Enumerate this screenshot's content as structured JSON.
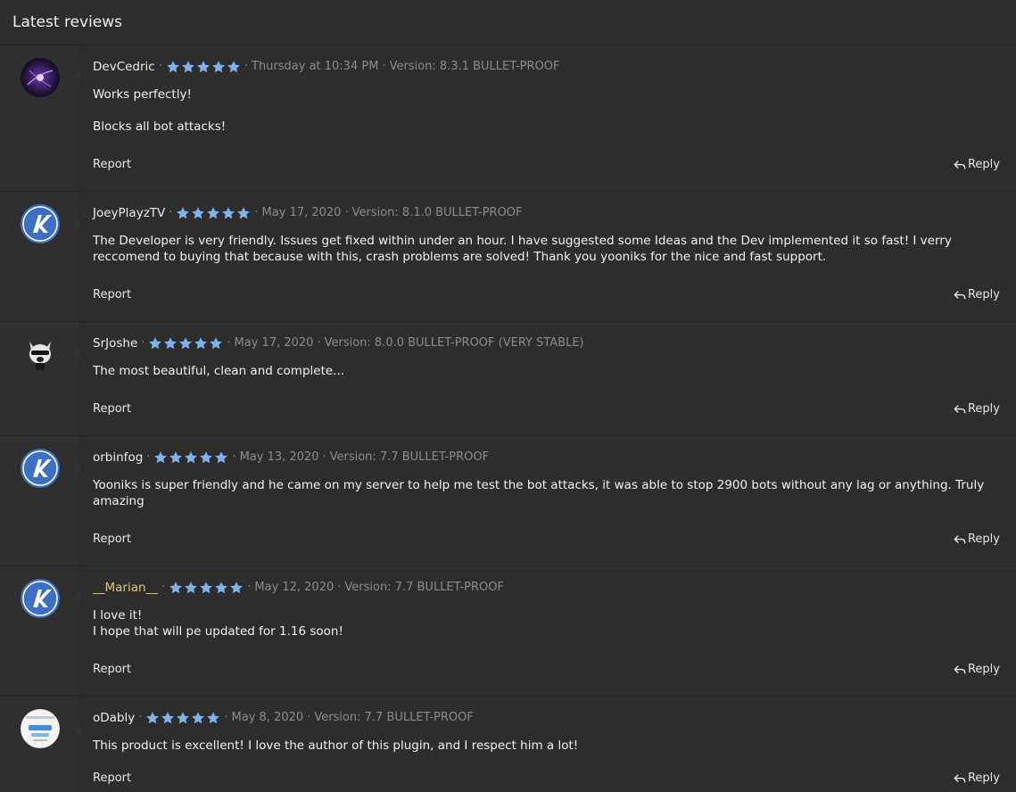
{
  "block": {
    "title": "Latest reviews"
  },
  "colors": {
    "star": "#7fb3ee",
    "highlight_user": "#e5c76b",
    "background": "#2d2d2d"
  },
  "reviews": [
    {
      "username": "DevCedric",
      "stars": 5,
      "date": "Thursday at 10:34 PM",
      "version": "Version: 8.3.1 BULLET-PROOF",
      "lines": [
        "Works perfectly!",
        "Blocks all bot attacks!"
      ],
      "report": "Report",
      "reply": "Reply",
      "avatar_icon": "purple-lights-avatar-icon"
    },
    {
      "username": "JoeyPlayzTV",
      "stars": 5,
      "date": "May 17, 2020",
      "version": "Version: 8.1.0 BULLET-PROOF",
      "lines": [
        "The Developer is very friendly. Issues get fixed within under an hour. I have suggested some Ideas and the Dev implemented it so fast! I verry reccomend to buying that because with this, crash problems are solved! Thank you yooniks for the nice and fast support."
      ],
      "report": "Report",
      "reply": "Reply",
      "avatar_icon": "k-logo-avatar-icon"
    },
    {
      "username": "SrJoshe",
      "stars": 5,
      "date": "May 17, 2020",
      "version": "Version: 8.0.0 BULLET-PROOF (VERY STABLE)",
      "lines": [
        "The most beautiful, clean and complete..."
      ],
      "report": "Report",
      "reply": "Reply",
      "avatar_icon": "raccoon-avatar-icon"
    },
    {
      "username": "orbinfog",
      "stars": 5,
      "date": "May 13, 2020",
      "version": "Version: 7.7 BULLET-PROOF",
      "lines": [
        "Yooniks is super friendly and he came on my server to help me test the bot attacks, it was able to stop 2900 bots without any lag or anything. Truly amazing"
      ],
      "report": "Report",
      "reply": "Reply",
      "avatar_icon": "k-logo-avatar-icon"
    },
    {
      "username": "__Marian__",
      "stars": 5,
      "date": "May 12, 2020",
      "version": "Version: 7.7 BULLET-PROOF",
      "lines": [
        "I love it!",
        "I hope that will pe updated for 1.16 soon!"
      ],
      "report": "Report",
      "reply": "Reply",
      "avatar_icon": "k-logo-avatar-icon"
    },
    {
      "username": "oDably",
      "stars": 5,
      "date": "May 8, 2020",
      "version": "Version: 7.7 BULLET-PROOF",
      "lines": [
        "This product is excellent! I love the author of this plugin, and I respect him a lot!"
      ],
      "report": "Report",
      "reply": "Reply",
      "avatar_icon": "blue-card-avatar-icon"
    }
  ]
}
